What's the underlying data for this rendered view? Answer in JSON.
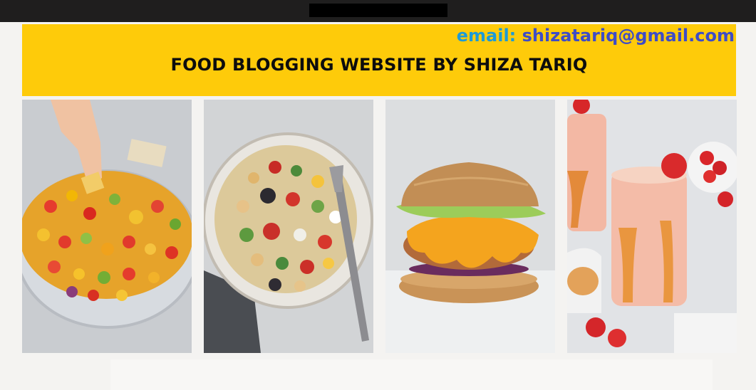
{
  "header": {
    "email_label": "email:",
    "email_value": "shizatariq@gmail.com",
    "title": "FOOD BLOGGING WEBSITE BY SHIZA TARIQ"
  },
  "colors": {
    "banner": "#fecb0a",
    "email_label": "#1d9ad6",
    "email_value": "#3e4cc6",
    "title": "#0d0d0d",
    "topbar": "#1f1e1e"
  },
  "gallery": [
    {
      "icon": "fruit-salsa-bowl-photo"
    },
    {
      "icon": "chickpea-salad-bowl-photo"
    },
    {
      "icon": "burger-photo"
    },
    {
      "icon": "strawberry-smoothie-photo"
    }
  ]
}
